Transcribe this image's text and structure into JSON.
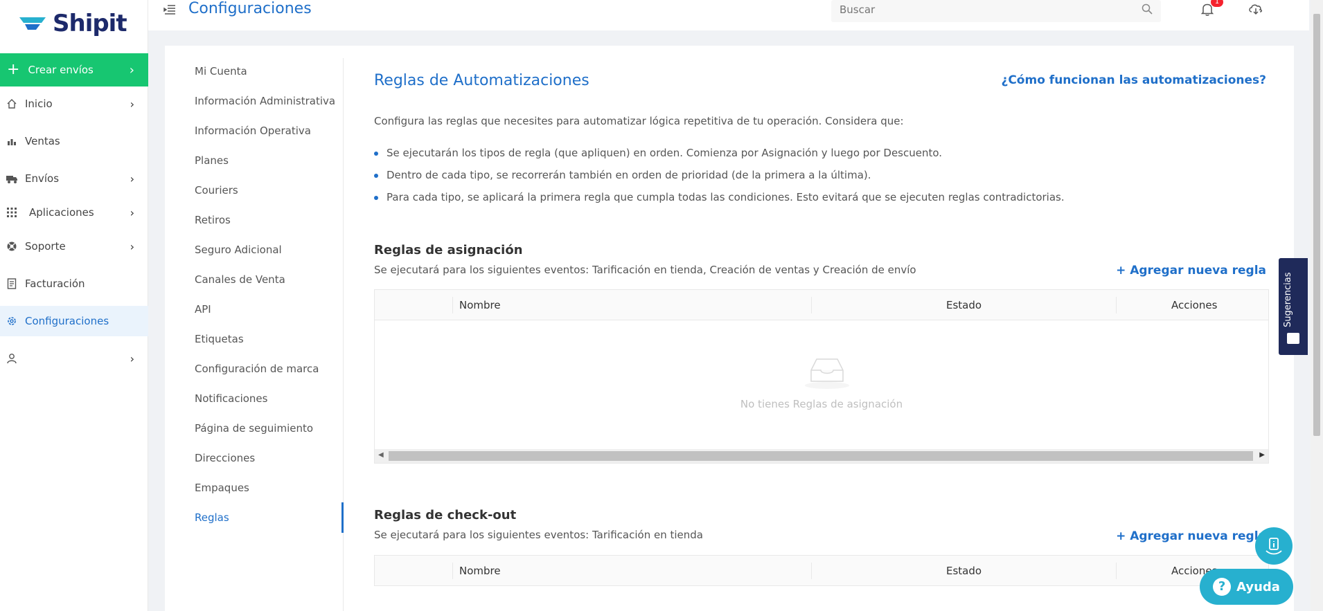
{
  "sidebar": {
    "logo": "Shipit",
    "create_label": "Crear envíos",
    "items": [
      {
        "label": "Inicio",
        "icon": "home-icon"
      },
      {
        "label": "Ventas",
        "icon": "sales-icon"
      },
      {
        "label": "Envíos",
        "icon": "truck-icon"
      },
      {
        "label": "Aplicaciones",
        "icon": "apps-grid-icon"
      },
      {
        "label": "Soporte",
        "icon": "support-icon"
      },
      {
        "label": "Facturación",
        "icon": "invoice-icon"
      },
      {
        "label": "Configuraciones",
        "icon": "gear-icon"
      },
      {
        "label": "",
        "icon": "user-icon"
      }
    ]
  },
  "header": {
    "title": "Configuraciones",
    "search_placeholder": "Buscar",
    "notification_count": "1"
  },
  "submenu": {
    "items": [
      "Mi Cuenta",
      "Información Administrativa",
      "Información Operativa",
      "Planes",
      "Couriers",
      "Retiros",
      "Seguro Adicional",
      "Canales de Venta",
      "API",
      "Etiquetas",
      "Configuración de marca",
      "Notificaciones",
      "Página de seguimiento",
      "Direcciones",
      "Empaques",
      "Reglas"
    ],
    "active": "Reglas"
  },
  "content": {
    "title": "Reglas de Automatizaciones",
    "help_link": "¿Cómo funcionan las automatizaciones?",
    "intro": "Configura las reglas que necesites para automatizar lógica repetitiva de tu operación. Considera que:",
    "bullets": [
      "Se ejecutarán los tipos de regla (que apliquen) en orden. Comienza por Asignación y luego por Descuento.",
      "Dentro de cada tipo, se recorrerán también en orden de prioridad (de la primera a la última).",
      "Para cada tipo, se aplicará la primera regla que cumpla todas las condiciones. Esto evitará que se ejecuten reglas contradictorias."
    ],
    "assignment": {
      "title": "Reglas de asignación",
      "subtitle": "Se ejecutará para los siguientes eventos: Tarificación en tienda, Creación de ventas y Creación de envío",
      "add_label": "+ Agregar nueva regla",
      "columns": [
        "Nombre",
        "Estado",
        "Acciones"
      ],
      "empty_text": "No tienes Reglas de asignación"
    },
    "checkout": {
      "title": "Reglas de check-out",
      "subtitle": "Se ejecutará para los siguientes eventos: Tarificación en tienda",
      "add_label": "+ Agregar nueva regla",
      "columns": [
        "Nombre",
        "Estado",
        "Acciones"
      ]
    }
  },
  "widgets": {
    "suggestions_label": "Sugerencias",
    "help_label": "Ayuda",
    "help_q": "?"
  },
  "colors": {
    "primary": "#1f6fc9",
    "create_green": "#17c671",
    "help_teal": "#27b0cf",
    "suggestions_navy": "#1f2a5a"
  }
}
